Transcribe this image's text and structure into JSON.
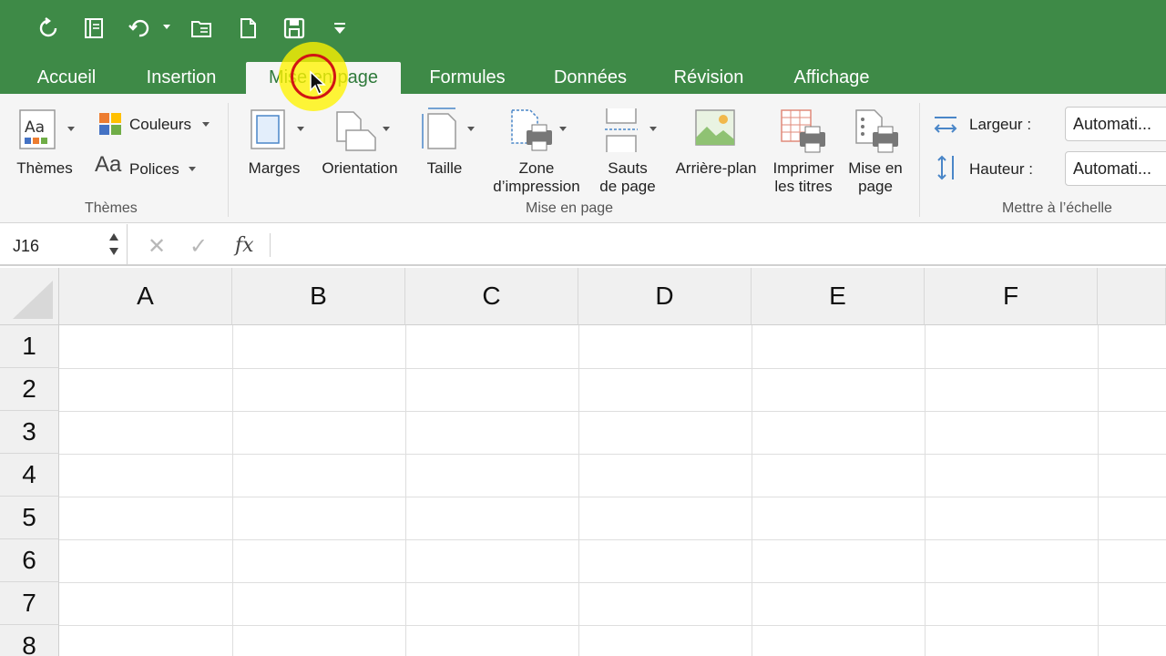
{
  "qat": {
    "icons": [
      "redo-icon",
      "notebook-icon",
      "undo-icon",
      "open-folder-icon",
      "new-doc-icon",
      "save-icon",
      "customize-qat-icon"
    ]
  },
  "tabs": [
    "Accueil",
    "Insertion",
    "Mise en page",
    "Formules",
    "Données",
    "Révision",
    "Affichage"
  ],
  "active_tab": "Mise en page",
  "ribbon": {
    "themes": {
      "themes_label": "Thèmes",
      "colors_label": "Couleurs",
      "fonts_label": "Polices",
      "fonts_icon_text": "Aa",
      "group_label": "Thèmes"
    },
    "page_setup": {
      "margins": "Marges",
      "orientation": "Orientation",
      "size": "Taille",
      "print_area_l1": "Zone",
      "print_area_l2": "d’impression",
      "breaks_l1": "Sauts",
      "breaks_l2": "de page",
      "background": "Arrière-plan",
      "print_titles_l1": "Imprimer",
      "print_titles_l2": "les titres",
      "page_layout_l1": "Mise en",
      "page_layout_l2": "page",
      "group_label": "Mise en page"
    },
    "scale": {
      "width_label": "Largeur :",
      "width_value": "Automati...",
      "height_label": "Hauteur :",
      "height_value": "Automati...",
      "group_label": "Mettre à l’échelle"
    }
  },
  "formula_bar": {
    "name_box": "J16",
    "fx": "fx",
    "cancel": "✕",
    "enter": "✓"
  },
  "columns": [
    "A",
    "B",
    "C",
    "D",
    "E",
    "F"
  ],
  "rows": [
    "1",
    "2",
    "3",
    "4",
    "5",
    "6",
    "7",
    "8"
  ],
  "colors": {
    "accent": "#3e8a47",
    "ribbon_bg": "#f5f5f5",
    "highlight": "#fff400",
    "ring": "#d11414"
  }
}
